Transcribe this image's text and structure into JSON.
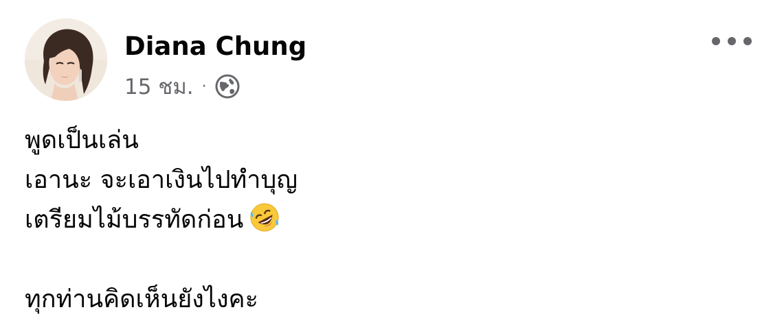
{
  "post": {
    "author_name": "Diana Chung",
    "timestamp": "15 ชม.",
    "separator": "·",
    "audience_icon": "globe-icon",
    "more_icon": "more-options-icon",
    "body_lines": [
      "พูดเป็นเล่น",
      "เอานะ จะเอาเงินไปทำบุญ",
      "เตรียมไม้บรรทัดก่อน",
      "",
      "ทุกท่านคิดเห็นยังไงคะ"
    ],
    "emoji": "rolling-on-floor-laughing-emoji",
    "colors": {
      "text": "#050505",
      "secondary": "#65676b",
      "emoji_face": "#f9c93a"
    }
  }
}
